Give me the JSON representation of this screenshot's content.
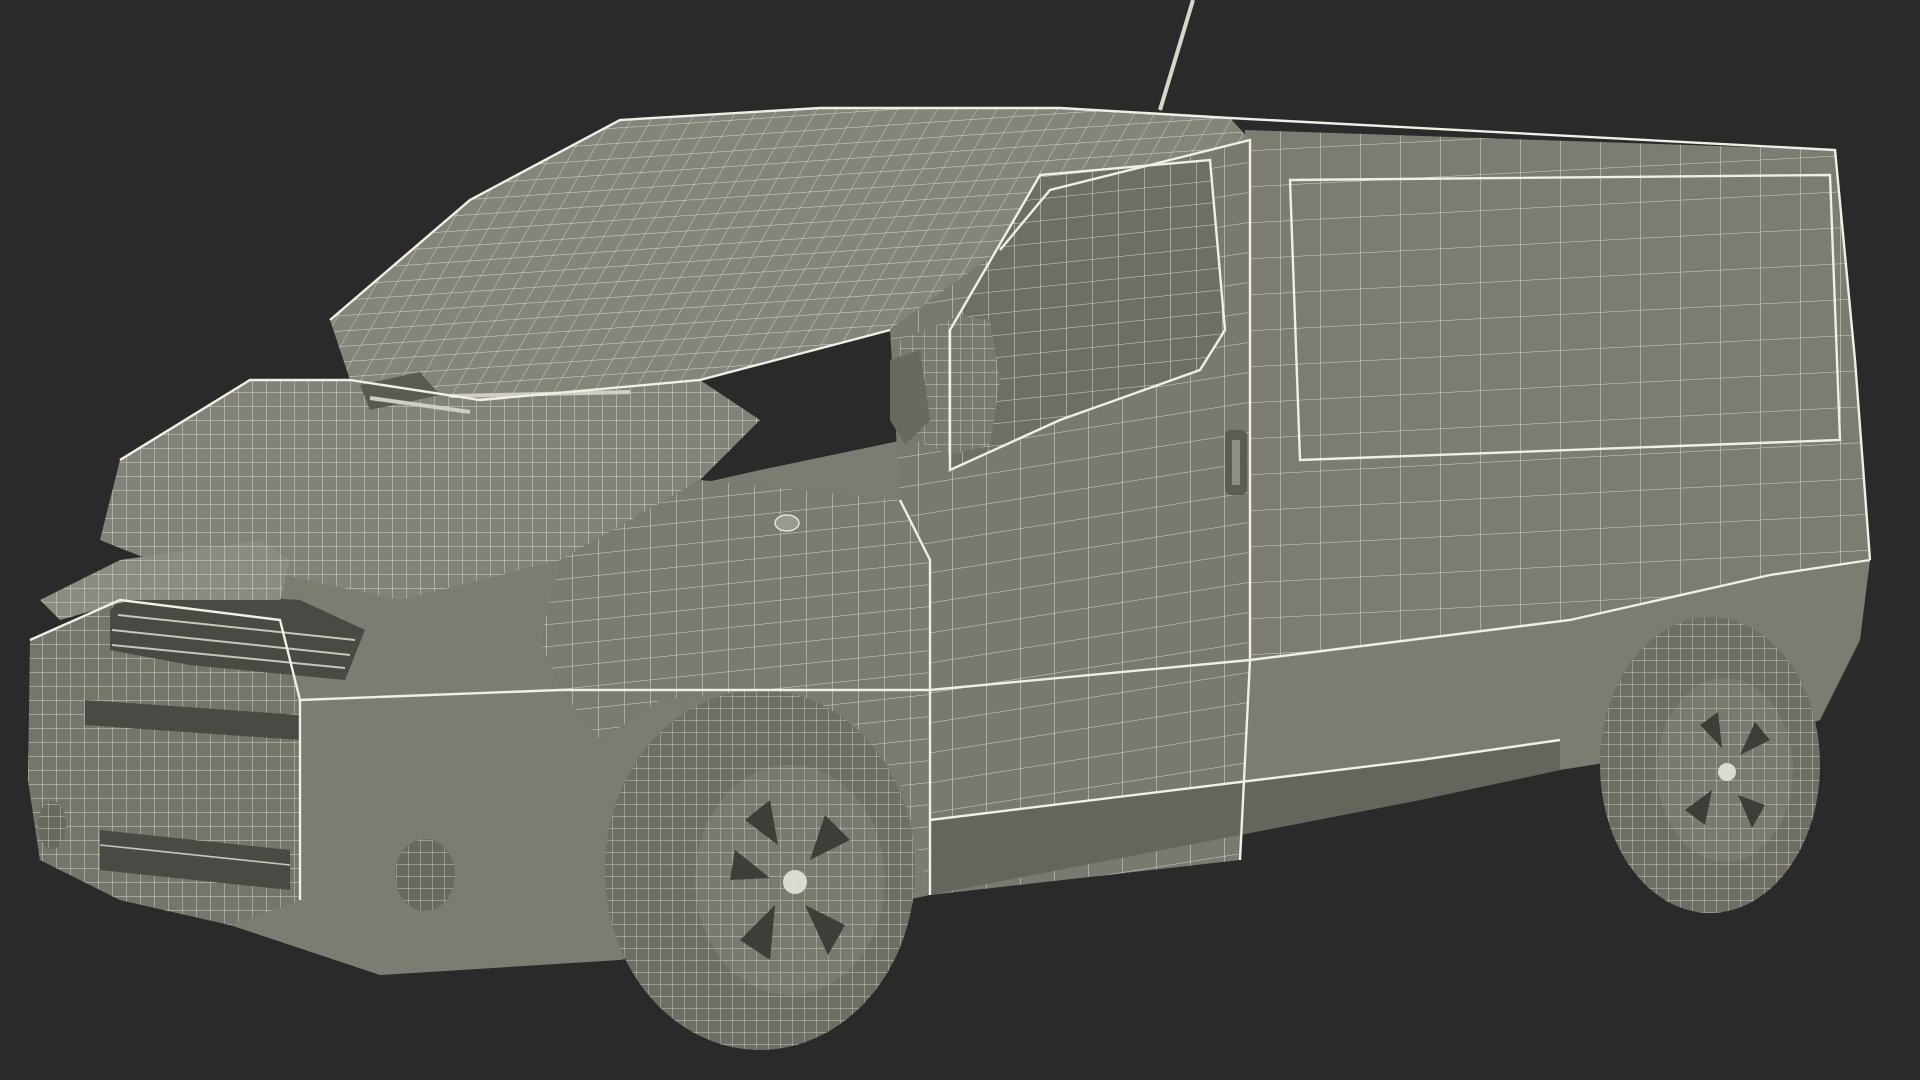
{
  "scene": {
    "subject": "van-wireframe-render",
    "colors": {
      "background": "#2a2a2a",
      "body": "#7d7c72",
      "body_shadow": "#5f5e56",
      "body_light": "#8e8d83",
      "wire": "#e6e4da",
      "dark_detail": "#3e3d38"
    }
  }
}
